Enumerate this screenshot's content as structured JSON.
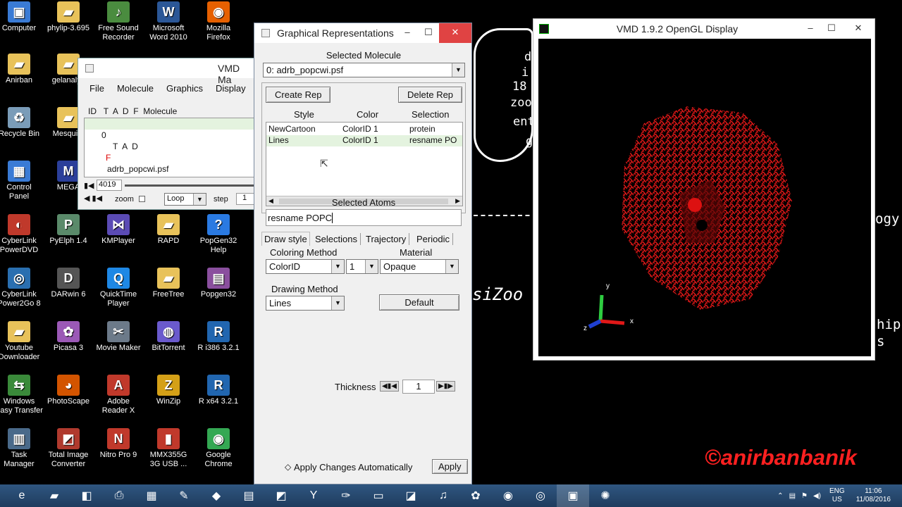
{
  "desktop": {
    "icons": [
      {
        "label": "Computer",
        "icon": "computer-icon",
        "glyph": "▣",
        "color": "#3a7bd5"
      },
      {
        "label": "phylip-3.695",
        "icon": "folder-icon",
        "glyph": "▰",
        "color": "#e8c25a"
      },
      {
        "label": "Free Sound\nRecorder",
        "icon": "recorder-icon",
        "glyph": "♪",
        "color": "#4a8c3f"
      },
      {
        "label": "Microsoft\nWord 2010",
        "icon": "word-icon",
        "glyph": "W",
        "color": "#2b5797"
      },
      {
        "label": "Mozilla\nFirefox",
        "icon": "firefox-icon",
        "glyph": "◉",
        "color": "#e66000"
      },
      {
        "label": "Anirban",
        "icon": "user-folder-icon",
        "glyph": "▰",
        "color": "#e8c25a"
      },
      {
        "label": "gelanalyz",
        "icon": "folder-icon",
        "glyph": "▰",
        "color": "#e8c25a"
      },
      {
        "label": "Recycle Bin",
        "icon": "recycle-bin-icon",
        "glyph": "♻",
        "color": "#7a9cb8"
      },
      {
        "label": "Mesquite",
        "icon": "folder-icon",
        "glyph": "▰",
        "color": "#e8c25a"
      },
      {
        "label": "Control\nPanel",
        "icon": "control-panel-icon",
        "glyph": "▦",
        "color": "#3a7bd5"
      },
      {
        "label": "MEGA",
        "icon": "mega-icon",
        "glyph": "M",
        "color": "#2b3f9a"
      },
      {
        "label": "CyberLink\nPowerDVD",
        "icon": "powerdvd-icon",
        "glyph": "◐",
        "color": "#c0392b"
      },
      {
        "label": "PyElph 1.4",
        "icon": "pyelph-icon",
        "glyph": "P",
        "color": "#5a8a6a"
      },
      {
        "label": "KMPlayer",
        "icon": "kmplayer-icon",
        "glyph": "⋈",
        "color": "#5b4bb5"
      },
      {
        "label": "RAPD",
        "icon": "folder-icon",
        "glyph": "▰",
        "color": "#e8c25a"
      },
      {
        "label": "PopGen32\nHelp",
        "icon": "help-icon",
        "glyph": "?",
        "color": "#2a7ae2"
      },
      {
        "label": "CyberLink\nPower2Go 8",
        "icon": "power2go-icon",
        "glyph": "◎",
        "color": "#2a6fb0"
      },
      {
        "label": "DARwin 6",
        "icon": "darwin-icon",
        "glyph": "D",
        "color": "#555555"
      },
      {
        "label": "QuickTime\nPlayer",
        "icon": "quicktime-icon",
        "glyph": "Q",
        "color": "#1e88e5"
      },
      {
        "label": "FreeTree",
        "icon": "folder-icon",
        "glyph": "▰",
        "color": "#e8c25a"
      },
      {
        "label": "Popgen32",
        "icon": "popgen-icon",
        "glyph": "▤",
        "color": "#8a4f9e"
      },
      {
        "label": "Youtube\nDownloader",
        "icon": "folder-icon",
        "glyph": "▰",
        "color": "#e8c25a"
      },
      {
        "label": "Picasa 3",
        "icon": "picasa-icon",
        "glyph": "✿",
        "color": "#9b59b6"
      },
      {
        "label": "Movie Maker",
        "icon": "movie-maker-icon",
        "glyph": "✂",
        "color": "#6c7a89"
      },
      {
        "label": "BitTorrent",
        "icon": "bittorrent-icon",
        "glyph": "◍",
        "color": "#6a5acd"
      },
      {
        "label": "R i386 3.2.1",
        "icon": "r-icon",
        "glyph": "R",
        "color": "#2166b0"
      },
      {
        "label": "Windows\nEasy Transfer",
        "icon": "easy-transfer-icon",
        "glyph": "⇆",
        "color": "#3a8a3a"
      },
      {
        "label": "PhotoScape",
        "icon": "photoscape-icon",
        "glyph": "◕",
        "color": "#d35400"
      },
      {
        "label": "Adobe\nReader X",
        "icon": "adobe-reader-icon",
        "glyph": "A",
        "color": "#c0392b"
      },
      {
        "label": "WinZip",
        "icon": "winzip-icon",
        "glyph": "Z",
        "color": "#d4a017"
      },
      {
        "label": "R x64 3.2.1",
        "icon": "r-icon",
        "glyph": "R",
        "color": "#2166b0"
      },
      {
        "label": "Task\nManager",
        "icon": "task-manager-icon",
        "glyph": "▥",
        "color": "#4a6a8a"
      },
      {
        "label": "Total Image\nConverter",
        "icon": "image-converter-icon",
        "glyph": "◩",
        "color": "#b03a2e"
      },
      {
        "label": "Nitro Pro 9",
        "icon": "nitro-icon",
        "glyph": "N",
        "color": "#c0392b"
      },
      {
        "label": "MMX355G\n3G USB ...",
        "icon": "modem-icon",
        "glyph": "▮",
        "color": "#c0392b"
      },
      {
        "label": "Google\nChrome",
        "icon": "chrome-icon",
        "glyph": "◉",
        "color": "#34a853"
      }
    ]
  },
  "vmd_main": {
    "title": "VMD Ma",
    "menu": [
      "File",
      "Molecule",
      "Graphics",
      "Display"
    ],
    "columns": "ID   T  A  D  F  Molecule",
    "row": {
      "id": "0",
      "flags": "T  A  D",
      "f": "F",
      "name": "adrb_popcwi.psf"
    },
    "frame": "4019",
    "zoom_label": "zoom",
    "loop_value": "Loop",
    "step_label": "step",
    "step_value": "1"
  },
  "graph_reps": {
    "title": "Graphical Representations",
    "selected_molecule_label": "Selected Molecule",
    "selected_molecule_value": "0: adrb_popcwi.psf",
    "create_rep": "Create Rep",
    "delete_rep": "Delete Rep",
    "rep_headers": {
      "style": "Style",
      "color": "Color",
      "selection": "Selection"
    },
    "reps": [
      {
        "style": "NewCartoon",
        "color": "ColorID 1",
        "selection": "protein"
      },
      {
        "style": "Lines",
        "color": "ColorID 1",
        "selection": "resname PO"
      }
    ],
    "selected_atoms_label": "Selected Atoms",
    "selected_atoms_value": "resname POPC",
    "tabs": [
      "Draw style",
      "Selections",
      "Trajectory",
      "Periodic"
    ],
    "coloring_method_label": "Coloring Method",
    "coloring_method_value": "ColorID",
    "color_id_value": "1",
    "material_label": "Material",
    "material_value": "Opaque",
    "drawing_method_label": "Drawing Method",
    "drawing_method_value": "Lines",
    "default_button": "Default",
    "thickness_label": "Thickness",
    "thickness_value": "1",
    "apply_auto": "Apply Changes Automatically",
    "apply": "Apply"
  },
  "opengl": {
    "title": "VMD 1.9.2 OpenGL Display",
    "axis_x": "x",
    "axis_y": "y",
    "axis_z": "z"
  },
  "background_text": {
    "lines": [
      "d",
      "i",
      "18",
      "zoo",
      "ent",
      "g"
    ],
    "sizoo": "siZoo",
    "ogy": "ogy",
    "hip": "hip",
    "s": "s"
  },
  "watermark": "©anirbanbanik",
  "taskbar": {
    "lang": "ENG",
    "region": "US",
    "time": "11:06",
    "date": "11/08/2016",
    "items": [
      "ie-icon",
      "explorer-icon",
      "store-icon",
      "printer-icon",
      "calculator-icon",
      "paint-icon",
      "rstudio-icon",
      "word-doc-icon",
      "image-viewer-icon",
      "yahoo-icon",
      "tool-icon",
      "display-icon",
      "image-icon",
      "mic-icon",
      "picasa-icon",
      "firefox-icon",
      "chrome-icon",
      "vmd-icon",
      "app-icon"
    ]
  }
}
